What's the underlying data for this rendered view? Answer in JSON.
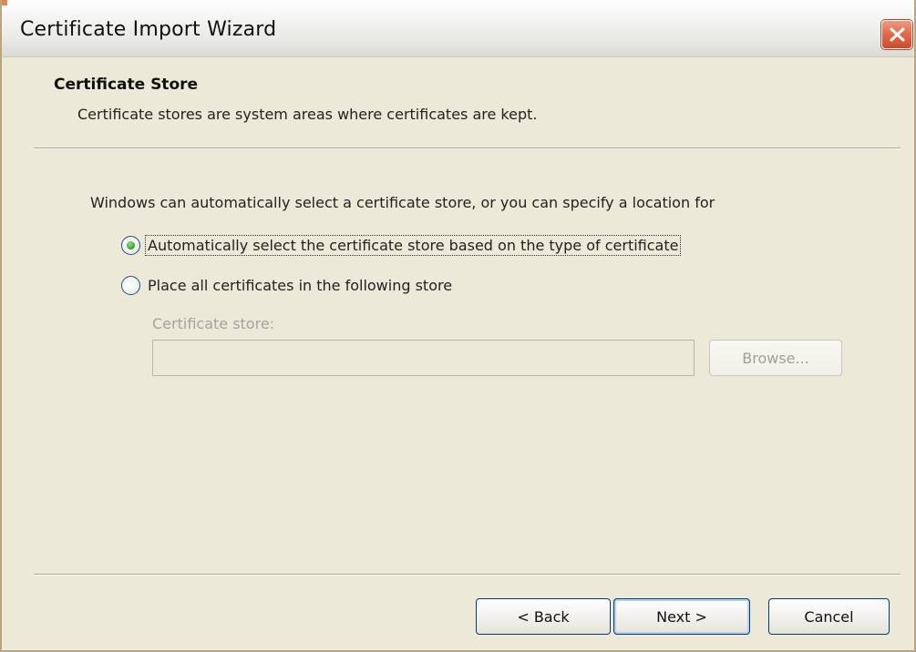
{
  "window": {
    "title": "Certificate Import Wizard",
    "close_icon": "close-icon"
  },
  "header": {
    "title": "Certificate Store",
    "subtitle": "Certificate stores are system areas where certificates are kept."
  },
  "body": {
    "intro": "Windows can automatically select a certificate store, or you can specify a location for",
    "options": [
      {
        "label": "Automatically select the certificate store based on the type of certificate",
        "selected": true
      },
      {
        "label": "Place all certificates in the following store",
        "selected": false
      }
    ],
    "store_label": "Certificate store:",
    "store_value": "",
    "browse_label": "Browse..."
  },
  "buttons": {
    "back": "< Back",
    "next": "Next >",
    "cancel": "Cancel"
  },
  "colors": {
    "dialog_bg": "#ece9d8",
    "close_red": "#e16c4f",
    "radio_green": "#3aa92a",
    "button_border": "#003c74",
    "disabled_text": "#a6a499"
  }
}
